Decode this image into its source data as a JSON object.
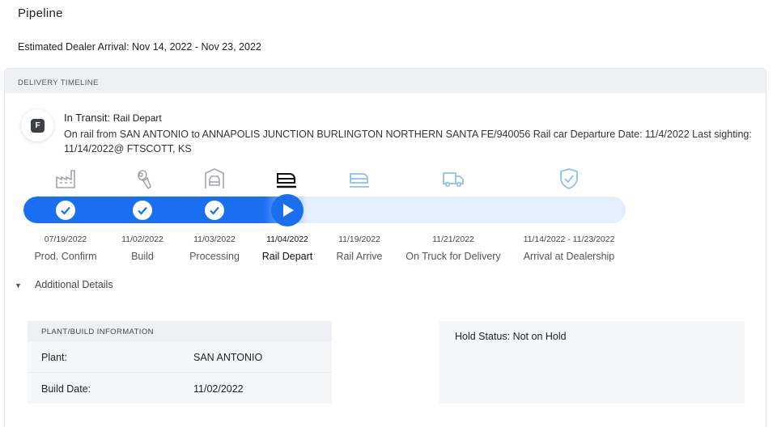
{
  "page": {
    "title": "Pipeline",
    "estimated_arrival": "Estimated Dealer Arrival: Nov 14, 2022 - Nov 23, 2022"
  },
  "timeline": {
    "header": "DELIVERY TIMELINE",
    "status_badge": "F",
    "status_prefix": "In Transit:",
    "status_value": "Rail Depart",
    "description": "On rail from SAN ANTONIO to ANNAPOLIS JUNCTION BURLINGTON NORTHERN SANTA FE/940056 Rail car Departure Date: 11/4/2022 Last sighting: 11/14/2022@ FTSCOTT, KS",
    "steps": [
      {
        "date": "07/19/2022",
        "label": "Prod. Confirm",
        "icon": "factory-icon",
        "state": "done"
      },
      {
        "date": "11/02/2022",
        "label": "Build",
        "icon": "wrench-icon",
        "state": "done"
      },
      {
        "date": "11/03/2022",
        "label": "Processing",
        "icon": "car-processing-icon",
        "state": "done"
      },
      {
        "date": "11/04/2022",
        "label": "Rail Depart",
        "icon": "train-icon",
        "state": "current"
      },
      {
        "date": "11/19/2022",
        "label": "Rail Arrive",
        "icon": "train-icon",
        "state": "upcoming"
      },
      {
        "date": "11/21/2022",
        "label": "On Truck for Delivery",
        "icon": "truck-icon",
        "state": "upcoming"
      },
      {
        "date": "11/14/2022 - 11/23/2022",
        "label": "Arrival at Dealership",
        "icon": "shield-check-icon",
        "state": "upcoming"
      }
    ],
    "colors": {
      "accent": "#1a6ff1",
      "track": "#e3efff",
      "done_icon": "#9a9da3",
      "upcoming_icon": "#8fc0e8"
    }
  },
  "details": {
    "toggle_label": "Additional Details",
    "plant": {
      "header": "PLANT/BUILD INFORMATION",
      "plant_label": "Plant:",
      "plant_value": "SAN ANTONIO",
      "build_date_label": "Build Date:",
      "build_date_value": "11/02/2022"
    },
    "hold_status": "Hold Status: Not on Hold"
  }
}
